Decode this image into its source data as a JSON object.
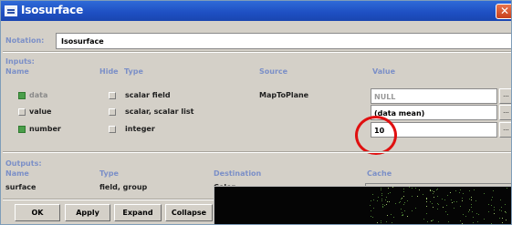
{
  "window": {
    "title": "Isosurface"
  },
  "header": {
    "notation_label": "Notation:",
    "notation_value": "Isosurface"
  },
  "inputs": {
    "section_label": "Inputs:",
    "columns": {
      "name": "Name",
      "hide": "Hide",
      "type": "Type",
      "source": "Source",
      "value": "Value"
    },
    "rows": [
      {
        "name": "data",
        "type": "scalar field",
        "source": "MapToPlane",
        "value": "NULL",
        "checked": true
      },
      {
        "name": "value",
        "type": "scalar, scalar list",
        "source": "",
        "value": "(data mean)",
        "checked": false
      },
      {
        "name": "number",
        "type": "integer",
        "source": "",
        "value": "10",
        "checked": true
      }
    ],
    "dots_label": "..."
  },
  "outputs": {
    "section_label": "Outputs:",
    "columns": {
      "name": "Name",
      "type": "Type",
      "destination": "Destination",
      "cache": "Cache"
    },
    "rows": [
      {
        "name": "surface",
        "type": "field, group",
        "destination": "Color"
      }
    ]
  },
  "buttons": {
    "ok": "OK",
    "apply": "Apply",
    "expand": "Expand",
    "collapse": "Collapse"
  },
  "colors": {
    "section_label": "#7b8fc7",
    "titlebar": "#1e4fc2",
    "annotation_circle": "#e01010"
  }
}
